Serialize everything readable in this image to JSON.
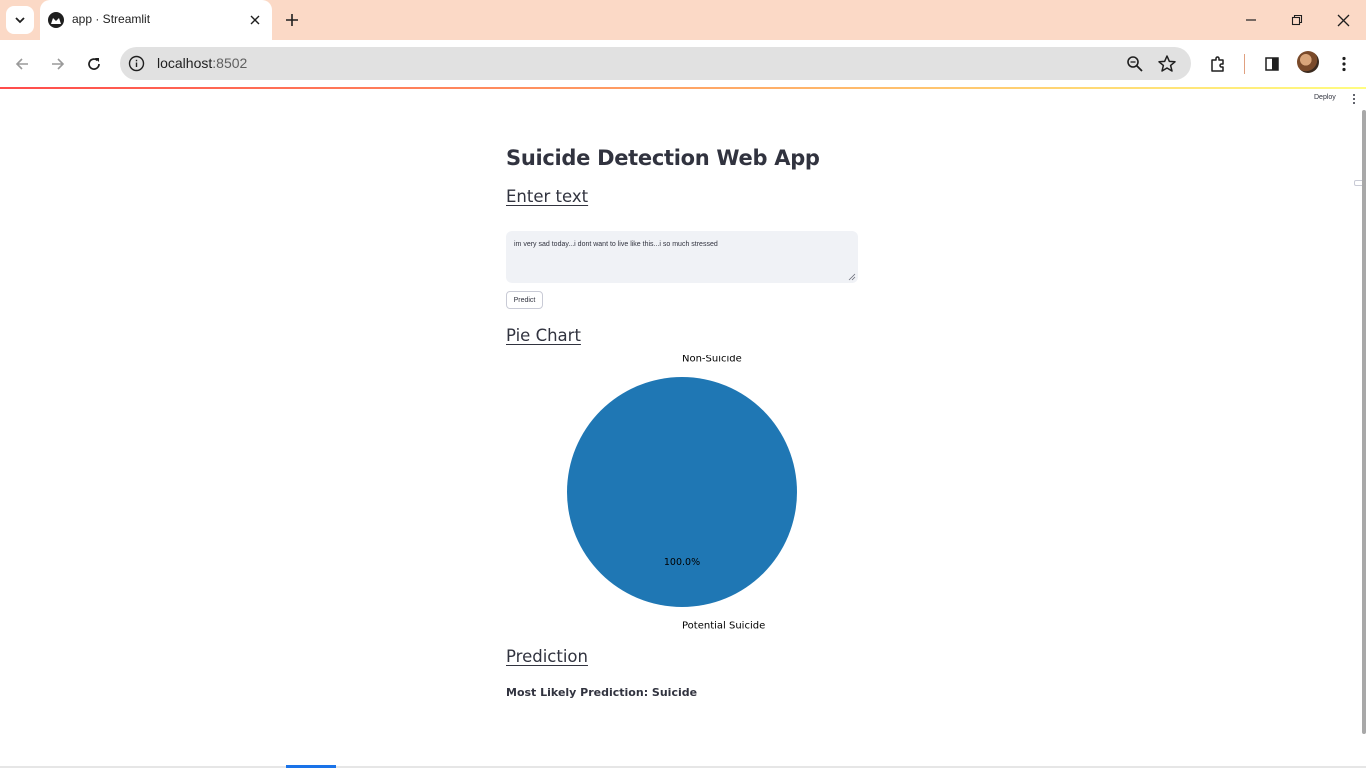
{
  "browser": {
    "tab_title": "app · Streamlit",
    "url_host": "localhost",
    "url_port": ":8502"
  },
  "app": {
    "deploy_label": "Deploy",
    "title": "Suicide Detection Web App",
    "enter_text_heading": "Enter text",
    "input_value": "im very sad today...i dont want to live like this...i so much stressed",
    "predict_label": "Predict",
    "pie_heading": "Pie Chart",
    "prediction_heading": "Prediction",
    "prediction_text": "Most Likely Prediction: Suicide"
  },
  "chart_data": {
    "type": "pie",
    "labels": [
      "Non-Suicide",
      "Potential Suicide"
    ],
    "values": [
      0.0,
      100.0
    ],
    "value_labels": [
      "0.0%",
      "100.0%"
    ],
    "colors": [
      "#ff7f0e",
      "#1f77b4"
    ],
    "title": ""
  }
}
